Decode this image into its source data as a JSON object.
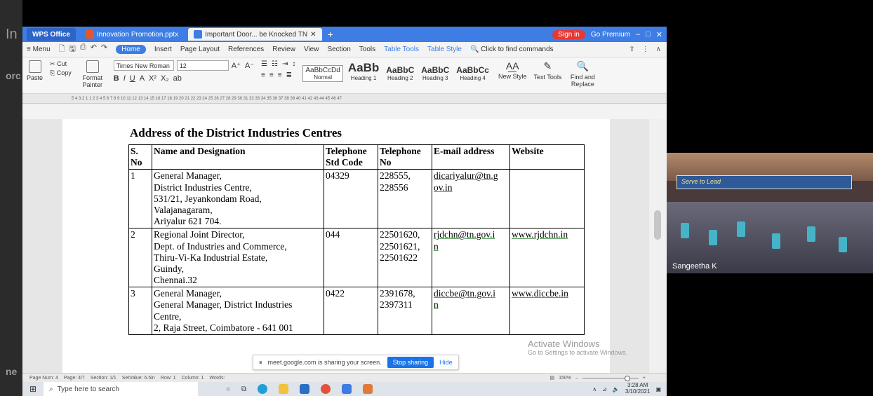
{
  "background_app": {
    "ghost_text_1": "In",
    "ghost_text_2": "orc",
    "ghost_text_3": "ne"
  },
  "tabs": [
    {
      "label": "WPS Office"
    },
    {
      "label": "Innovation Promotion.pptx"
    },
    {
      "label": "Important Door... be Knocked TN"
    }
  ],
  "titlebar": {
    "signin": "Sign in",
    "premium": "Go Premium"
  },
  "menu": {
    "menu_label": "Menu",
    "items": [
      "Home",
      "Insert",
      "Page Layout",
      "References",
      "Review",
      "View",
      "Section",
      "Tools",
      "Table Tools",
      "Table Style"
    ],
    "search_placeholder": "Click to find commands"
  },
  "ribbon": {
    "paste": "Paste",
    "cut": "Cut",
    "copy": "Copy",
    "format_painter": "Format Painter",
    "font_name": "Times New Roman",
    "font_size": "12",
    "styles": [
      {
        "sample": "AaBbCcDd",
        "label": "Normal"
      },
      {
        "sample": "AaBb",
        "label": "Heading 1"
      },
      {
        "sample": "AaBbC",
        "label": "Heading 2"
      },
      {
        "sample": "AaBbC",
        "label": "Heading 3"
      },
      {
        "sample": "AaBbCc",
        "label": "Heading 4"
      }
    ],
    "new_style": "New Style",
    "text_tools": "Text Tools",
    "find_replace": "Find and Replace"
  },
  "ruler": {
    "marks": "5 4 3 2 1 1 2 3 4 5 6 7 8 9 10 11 12 13 14 15 16 17 18 19 20 21 22 23 24 25 26 27 28 29 30 31 32 33 34 35 36 37 38 39 40 41 42 43 44 45 46 47"
  },
  "document": {
    "title": "Address of the District Industries Centres",
    "columns": [
      "S. No",
      "Name and Designation",
      "Telephone Std Code",
      "Telephone No",
      "E-mail address",
      "Website"
    ],
    "rows": [
      {
        "sno": "1",
        "name_lines": [
          "General Manager,",
          "District Industries Centre,",
          "531/21, Jeyankondam Road,",
          "Valajanagaram,",
          "Ariyalur 621 704."
        ],
        "std": "04329",
        "tel_lines": [
          "228555,",
          "228556"
        ],
        "email_lines": [
          "dicariyalur@tn.g",
          "ov.in"
        ],
        "web": ""
      },
      {
        "sno": "2",
        "name_lines": [
          "Regional Joint Director,",
          "Dept. of Industries and Commerce,",
          "Thiru-Vi-Ka Industrial Estate,",
          "Guindy,",
          "Chennai.32"
        ],
        "std": "044",
        "tel_lines": [
          "22501620,",
          "22501621,",
          "22501622"
        ],
        "email_lines": [
          "rjdchn@tn.gov.i",
          "n"
        ],
        "web": "www.rjdchn.in"
      },
      {
        "sno": "3",
        "name_lines": [
          "General Manager,",
          "General Manager, District Industries",
          "Centre,",
          "2, Raja Street, Coimbatore - 641 001"
        ],
        "std": "0422",
        "tel_lines": [
          "2391678,",
          "2397311"
        ],
        "email_lines": [
          "diccbe@tn.gov.i",
          "n"
        ],
        "web": "www.diccbe.in"
      }
    ]
  },
  "watermark": {
    "title": "Activate Windows",
    "subtitle": "Go to Settings to activate Windows."
  },
  "sharebar": {
    "message": "meet.google.com is sharing your screen.",
    "stop": "Stop sharing",
    "hide": "Hide"
  },
  "statusbar": {
    "page_num": "Page Num: 4",
    "page": "Page: 4/7",
    "section": "Section: 1/1",
    "setvalue": "SetValue: 6.5in",
    "row": "Row: 1",
    "column": "Column: 1",
    "words": "Words:",
    "zoom": "150%"
  },
  "taskbar": {
    "search_placeholder": "Type here to search",
    "time": "3:28 AM",
    "date": "3/10/2021"
  },
  "video": {
    "participant": "Sangeetha K",
    "banner": "Serve to Lead"
  },
  "colors": {
    "wps_blue": "#3d7de4",
    "signin_red": "#e53935",
    "meet_blue": "#1a73e8"
  }
}
